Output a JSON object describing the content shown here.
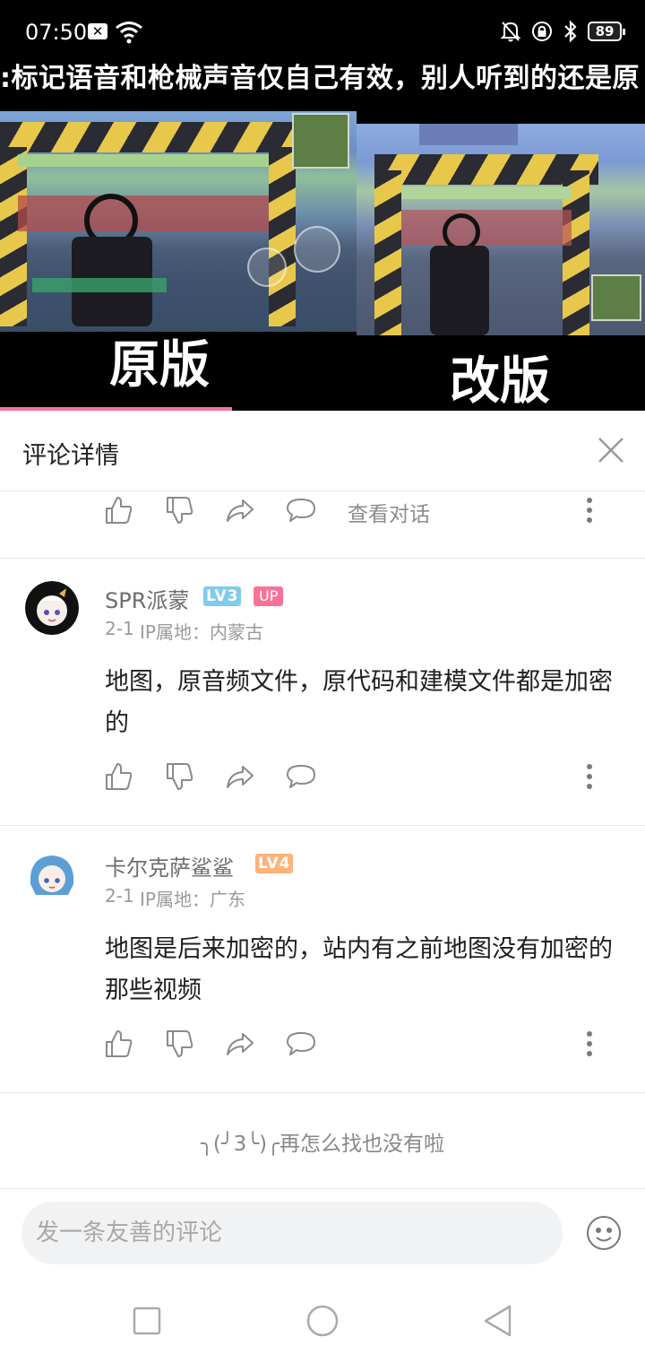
{
  "status_bar": {
    "time": "07:50",
    "x_badge": "✕",
    "battery": "89"
  },
  "video": {
    "subtitle": ":标记语音和枪械声音仅自己有效，别人听到的还是原",
    "label_left": "原版",
    "label_right": "改版",
    "progress_fraction": 0.36
  },
  "header": {
    "title": "评论详情"
  },
  "top_actions": {
    "view_conversation": "查看对话"
  },
  "comments": [
    {
      "username": "SPR派蒙",
      "level": "LV3",
      "badge": "UP",
      "date": "2-1",
      "ip": "IP属地：内蒙古",
      "text": "地图，原音频文件，原代码和建模文件都是加密的"
    },
    {
      "username": "卡尔克萨鲨鲨",
      "level": "LV4",
      "date": "2-1",
      "ip": "IP属地：广东",
      "text": "地图是后来加密的，站内有之前地图没有加密的那些视频"
    }
  ],
  "end_note": "╮(╯3╰)╭再怎么找也没有啦",
  "input": {
    "placeholder": "发一条友善的评论"
  },
  "colors": {
    "accent": "#fb7299",
    "lv3": "#7fcbee",
    "lv4": "#ffb37c"
  }
}
